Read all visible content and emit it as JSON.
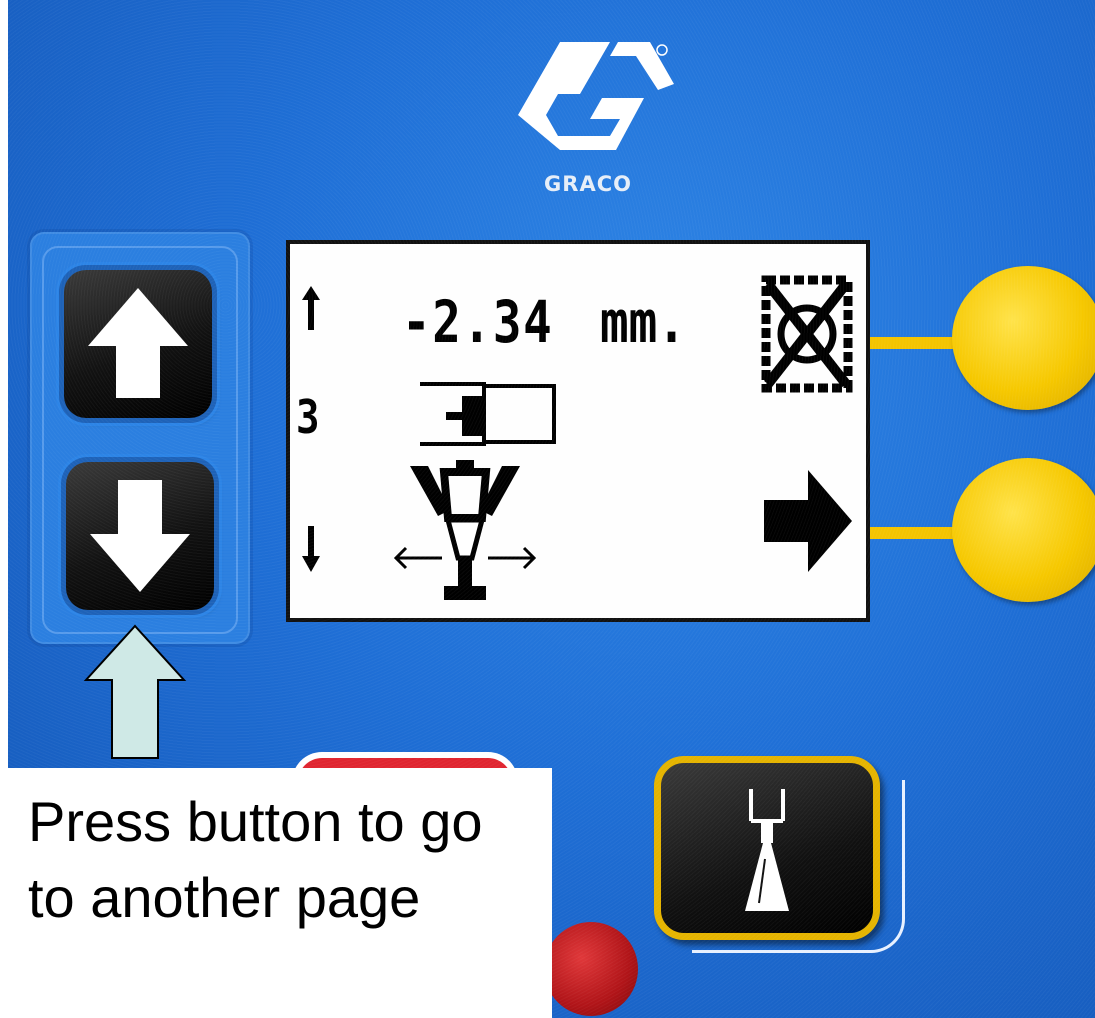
{
  "brand": {
    "logo_text": "GRACO"
  },
  "display": {
    "value": "-2.34",
    "unit": "mm.",
    "row_number": "3",
    "icons": [
      "scroll-up-arrow-icon",
      "scroll-down-arrow-icon",
      "cylinder-position-icon",
      "spray-gun-pattern-icon",
      "no-spray-icon",
      "next-page-arrow-icon"
    ]
  },
  "callout": {
    "text": "Press button to go to another page"
  },
  "colors": {
    "panel_blue": "#1f6fd6",
    "soft_key_yellow": "#f6c800",
    "lcd_background": "#fefefe",
    "callout_arrow_fill": "#cfe9e6"
  }
}
